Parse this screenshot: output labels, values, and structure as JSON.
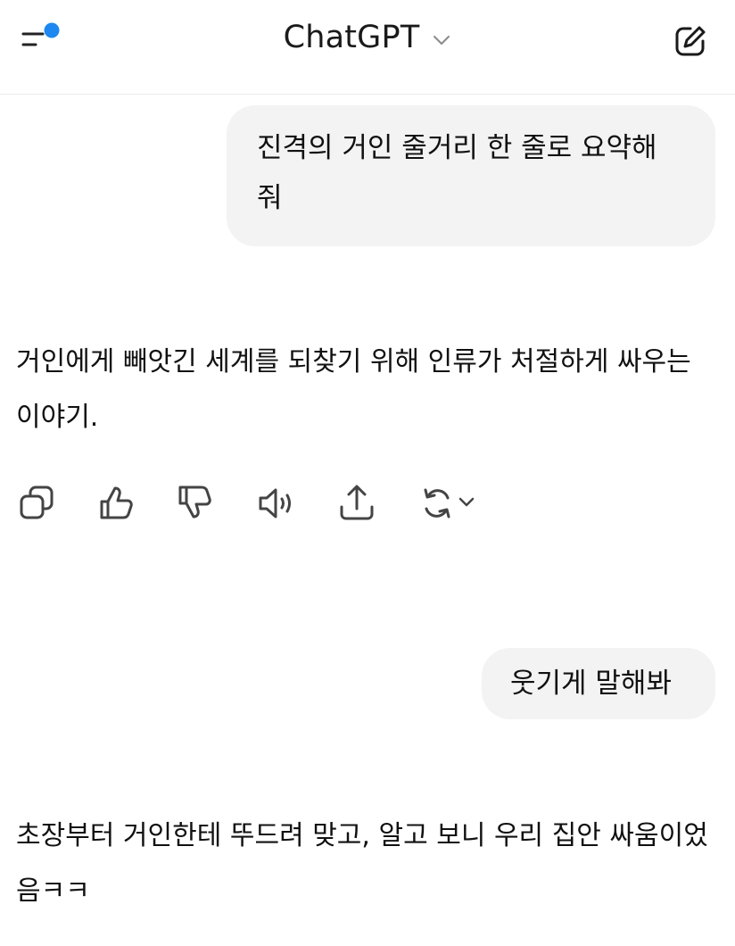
{
  "header": {
    "title": "ChatGPT",
    "accent_color": "#1e88f0",
    "icons": [
      "sidebar-menu-icon",
      "chevron-down-icon",
      "new-chat-icon"
    ]
  },
  "conversation": [
    {
      "role": "user",
      "text": "진격의 거인 줄거리 한 줄로 요약해 줘"
    },
    {
      "role": "assistant",
      "text": "거인에게 빼앗긴 세계를 되찾기 위해 인류가 처절하게 싸우는 이야기."
    },
    {
      "role": "user",
      "text": "웃기게 말해봐"
    },
    {
      "role": "assistant",
      "text": "초장부터 거인한테 뚜드려 맞고, 알고 보니 우리 집안 싸움이었음ㅋㅋ"
    }
  ],
  "message_actions": {
    "icons": [
      "copy-icon",
      "thumbs-up-icon",
      "thumbs-down-icon",
      "read-aloud-icon",
      "share-icon",
      "regenerate-icon",
      "chevron-down-icon"
    ]
  }
}
